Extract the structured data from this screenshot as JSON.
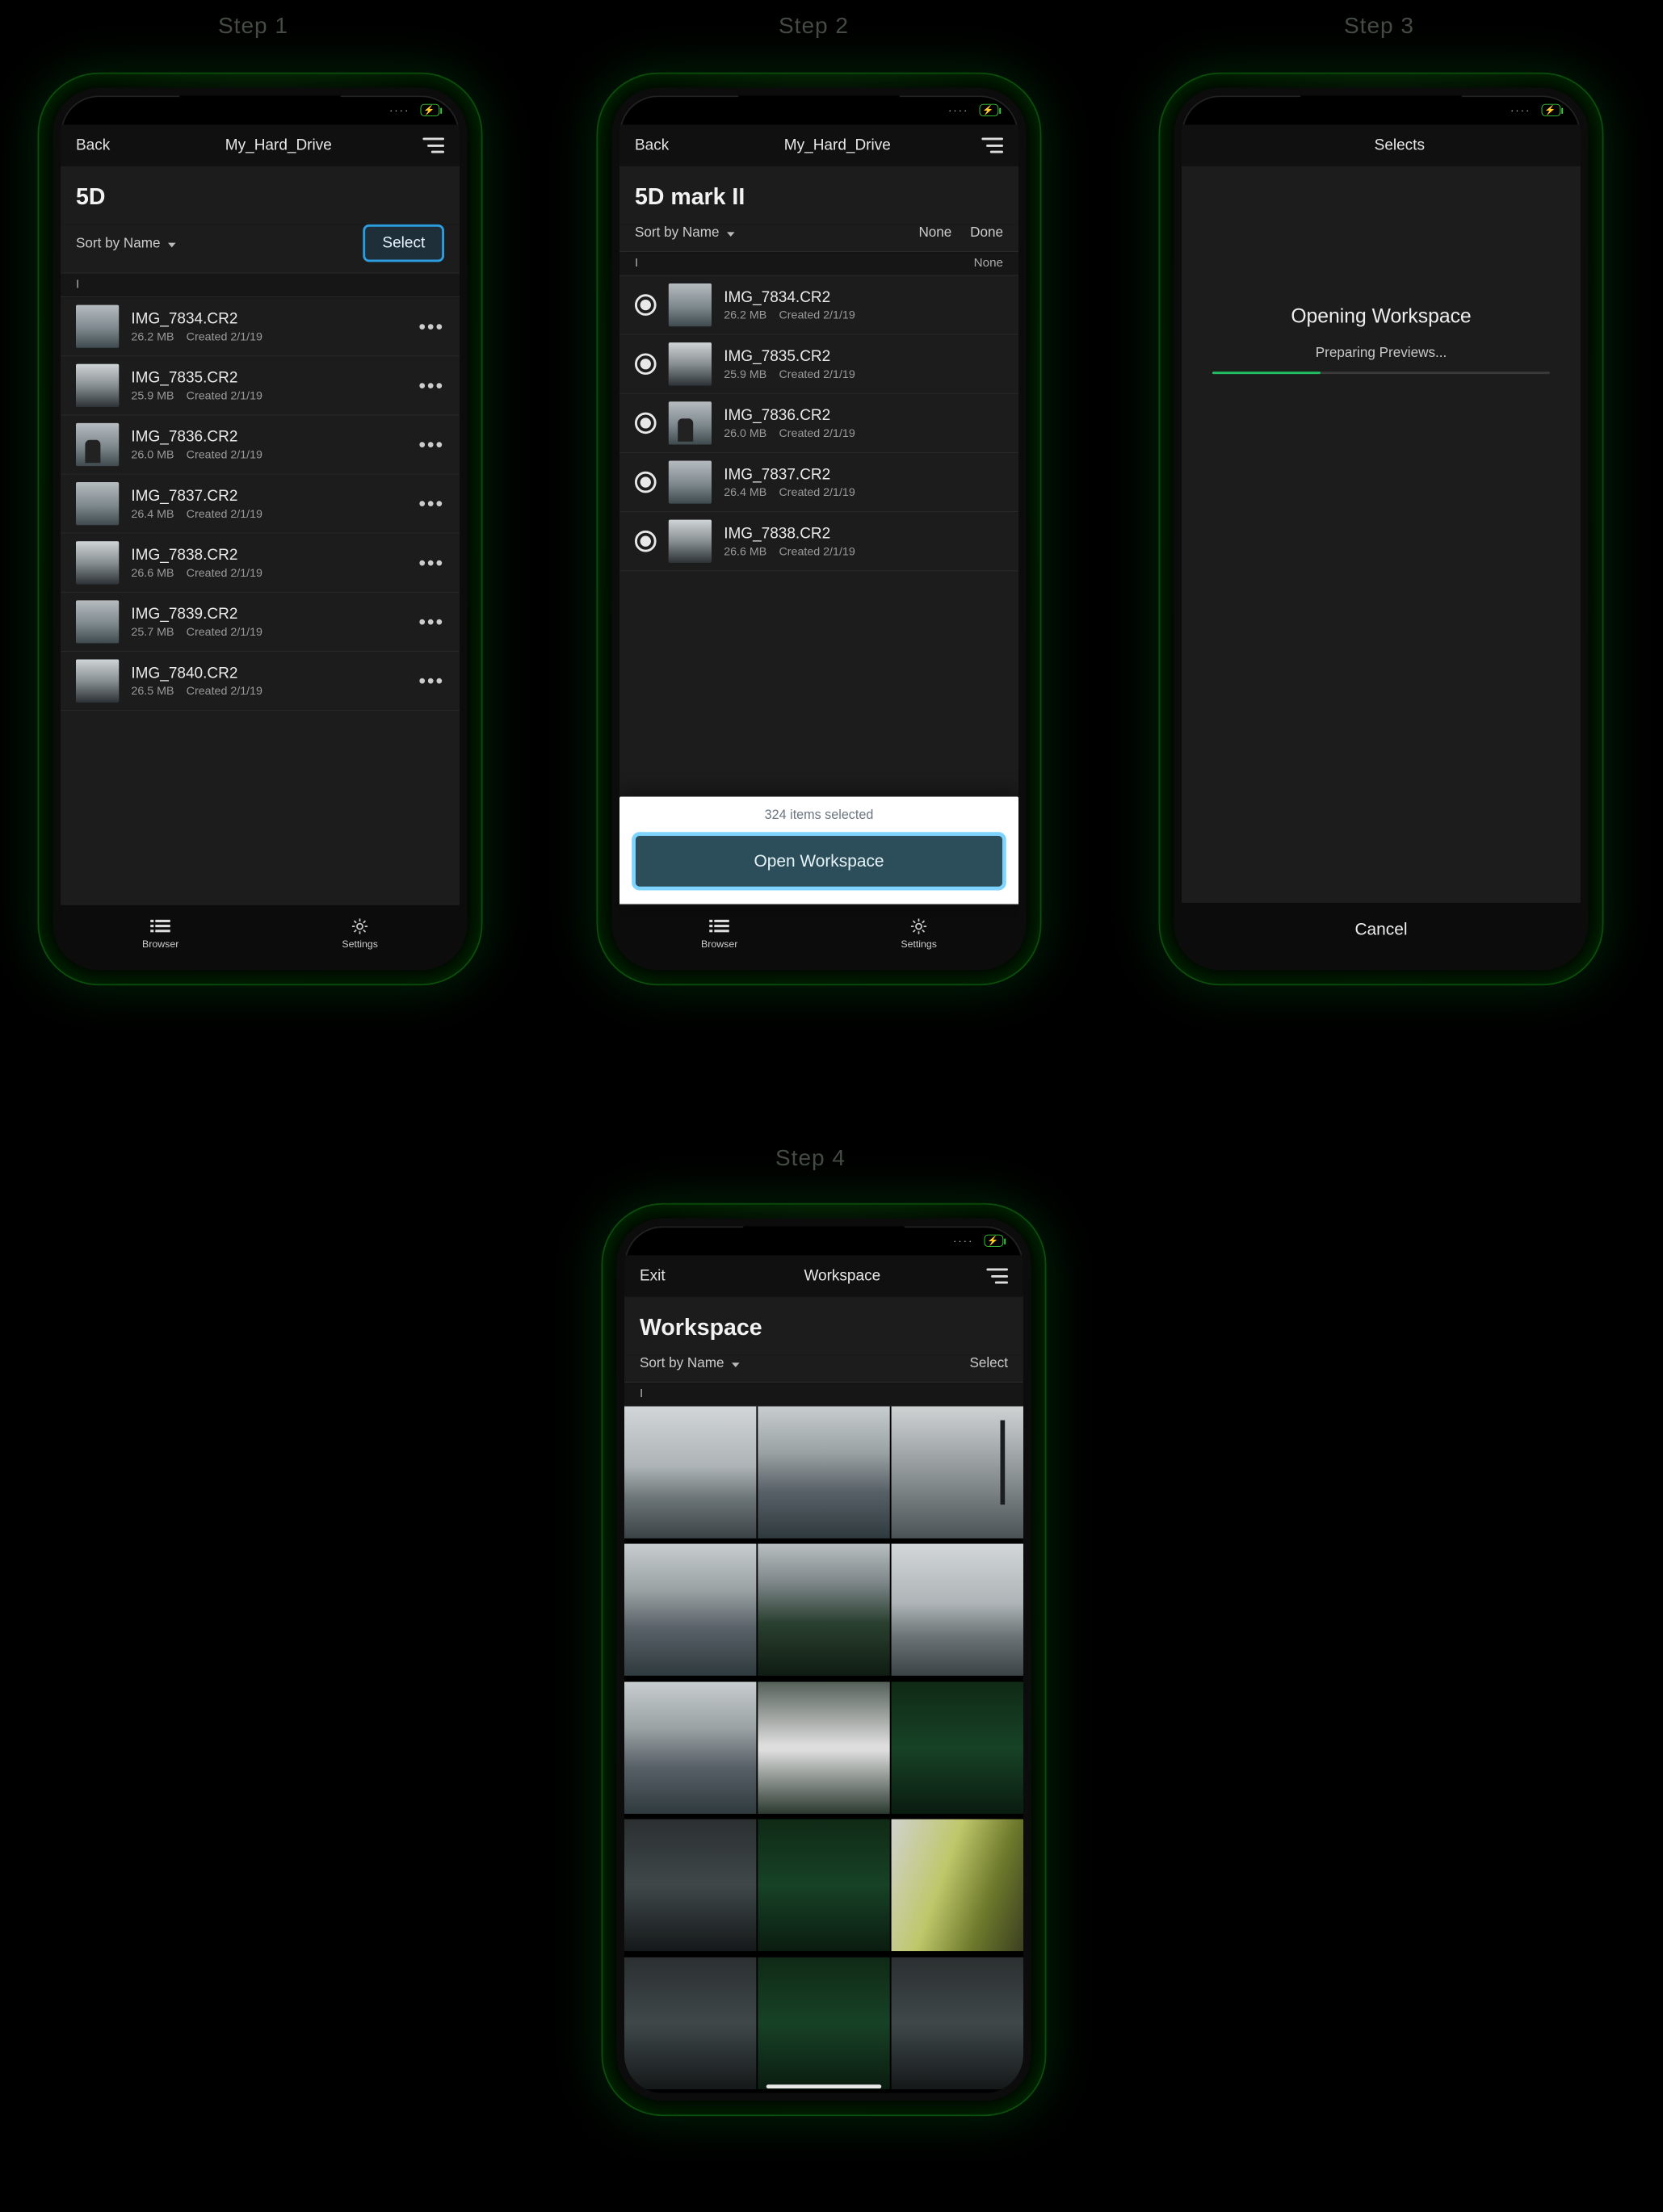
{
  "steps": {
    "s1": "Step 1",
    "s2": "Step 2",
    "s3": "Step 3",
    "s4": "Step 4"
  },
  "screen1": {
    "nav_back": "Back",
    "nav_title": "My_Hard_Drive",
    "folder_title": "5D",
    "sort_label": "Sort by Name",
    "select_label": "Select",
    "section_letter": "I",
    "files": [
      {
        "name": "IMG_7834.CR2",
        "size": "26.2 MB",
        "created": "Created 2/1/19"
      },
      {
        "name": "IMG_7835.CR2",
        "size": "25.9 MB",
        "created": "Created 2/1/19"
      },
      {
        "name": "IMG_7836.CR2",
        "size": "26.0 MB",
        "created": "Created 2/1/19"
      },
      {
        "name": "IMG_7837.CR2",
        "size": "26.4 MB",
        "created": "Created 2/1/19"
      },
      {
        "name": "IMG_7838.CR2",
        "size": "26.6 MB",
        "created": "Created 2/1/19"
      },
      {
        "name": "IMG_7839.CR2",
        "size": "25.7 MB",
        "created": "Created 2/1/19"
      },
      {
        "name": "IMG_7840.CR2",
        "size": "26.5 MB",
        "created": "Created 2/1/19"
      }
    ],
    "tab_browser": "Browser",
    "tab_settings": "Settings"
  },
  "screen2": {
    "nav_back": "Back",
    "nav_title": "My_Hard_Drive",
    "folder_title": "5D mark II",
    "sort_label": "Sort by Name",
    "none_label": "None",
    "done_label": "Done",
    "section_letter": "I",
    "section_right": "None",
    "files": [
      {
        "name": "IMG_7834.CR2",
        "size": "26.2 MB",
        "created": "Created 2/1/19"
      },
      {
        "name": "IMG_7835.CR2",
        "size": "25.9 MB",
        "created": "Created 2/1/19"
      },
      {
        "name": "IMG_7836.CR2",
        "size": "26.0 MB",
        "created": "Created 2/1/19"
      },
      {
        "name": "IMG_7837.CR2",
        "size": "26.4 MB",
        "created": "Created 2/1/19"
      },
      {
        "name": "IMG_7838.CR2",
        "size": "26.6 MB",
        "created": "Created 2/1/19"
      }
    ],
    "sheet_caption": "324 items selected",
    "open_workspace": "Open Workspace",
    "tab_browser": "Browser",
    "tab_settings": "Settings"
  },
  "screen3": {
    "nav_title": "Selects",
    "opening_title": "Opening Workspace",
    "prep_text": "Preparing Previews...",
    "progress_pct": 32,
    "cancel_label": "Cancel"
  },
  "screen4": {
    "nav_exit": "Exit",
    "nav_title": "Workspace",
    "page_title": "Workspace",
    "sort_label": "Sort by Name",
    "select_label": "Select",
    "section_letter": "I"
  },
  "battery_icon": "⚡"
}
